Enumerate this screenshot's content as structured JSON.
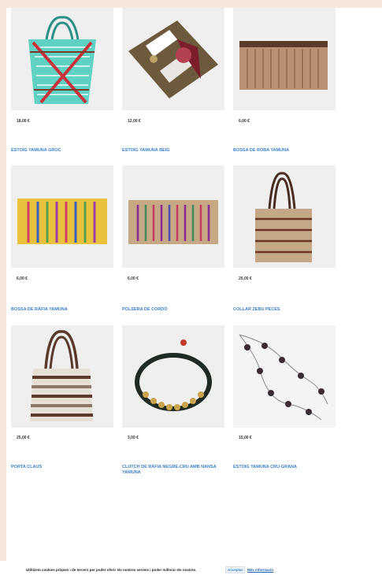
{
  "products": [
    {
      "price": "18,00 €",
      "name": "ESTOIG YAMUNA GROC",
      "image": "woven-basket-teal-red"
    },
    {
      "price": "12,00 €",
      "name": "ESTOIG YAMUNA BEIG",
      "image": "patchwork-pouch"
    },
    {
      "price": "6,00 €",
      "name": "BOSSA DE ROBA YAMUNA",
      "image": "raffia-clutch-beige"
    },
    {
      "price": "6,00 €",
      "name": "BOSSA DE RÀFIA YAMUNA",
      "image": "raffia-clutch-yellow-striped"
    },
    {
      "price": "6,00 €",
      "name": "POLSERA DE CORDÓ",
      "image": "raffia-clutch-purple-striped"
    },
    {
      "price": "20,00 €",
      "name": "COLLAR ZEBU PECES",
      "image": "jute-tote-brown-stripes"
    },
    {
      "price": "25,00 €",
      "name": "PORTA CLAUS",
      "image": "striped-tote-bag"
    },
    {
      "price": "3,00 €",
      "name": "CLUTCH DE RÀFIA NEGRE-CRU AMB NANSA YAMUNA",
      "image": "beaded-bracelet"
    },
    {
      "price": "15,00 €",
      "name": "ESTOIG YAMUNA CRU-GRANA",
      "image": "bead-necklace"
    }
  ],
  "cookie": {
    "text": "Utilitzem cookies pròpies i de tercers per poder oferir els nostres serveis i poder millorar els nostres.",
    "accept": "Acceptar",
    "more": "Més informació"
  }
}
